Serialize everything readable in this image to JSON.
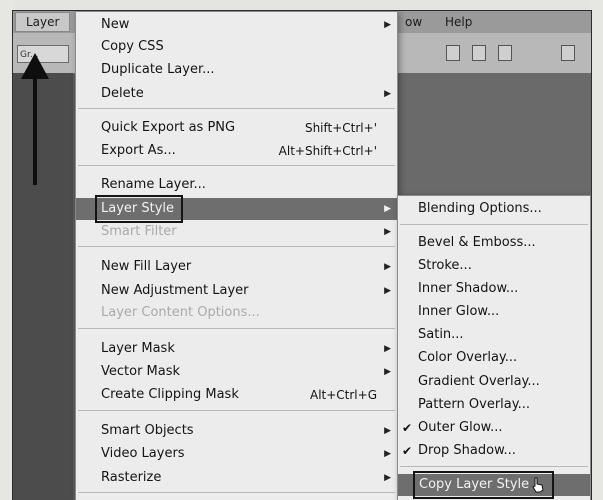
{
  "menubar": {
    "layer": "Layer",
    "window_fragment": "ow",
    "help": "Help",
    "mode_value": "Gr..."
  },
  "layer_menu": {
    "items": [
      {
        "label": "New"
      },
      {
        "label": "Copy CSS"
      },
      {
        "label": "Duplicate Layer..."
      },
      {
        "label": "Delete"
      },
      {
        "label": "Quick Export as PNG",
        "shortcut": "Shift+Ctrl+'"
      },
      {
        "label": "Export As...",
        "shortcut": "Alt+Shift+Ctrl+'"
      },
      {
        "label": "Rename Layer..."
      },
      {
        "label": "Layer Style"
      },
      {
        "label": "Smart Filter"
      },
      {
        "label": "New Fill Layer"
      },
      {
        "label": "New Adjustment Layer"
      },
      {
        "label": "Layer Content Options..."
      },
      {
        "label": "Layer Mask"
      },
      {
        "label": "Vector Mask"
      },
      {
        "label": "Create Clipping Mask",
        "shortcut": "Alt+Ctrl+G"
      },
      {
        "label": "Smart Objects"
      },
      {
        "label": "Video Layers"
      },
      {
        "label": "Rasterize"
      }
    ]
  },
  "layer_style_submenu": {
    "items": [
      {
        "label": "Blending Options..."
      },
      {
        "label": "Bevel & Emboss..."
      },
      {
        "label": "Stroke..."
      },
      {
        "label": "Inner Shadow..."
      },
      {
        "label": "Inner Glow..."
      },
      {
        "label": "Satin..."
      },
      {
        "label": "Color Overlay..."
      },
      {
        "label": "Gradient Overlay..."
      },
      {
        "label": "Pattern Overlay..."
      },
      {
        "label": "Outer Glow...",
        "checked": true
      },
      {
        "label": "Drop Shadow...",
        "checked": true
      },
      {
        "label": "Copy Layer Style"
      }
    ]
  },
  "colors": {
    "menu_bg": "#ececec",
    "highlight_bg": "#6e6e6e",
    "disabled_text": "#aaaaaa",
    "annotation": "#141414"
  },
  "icons": {
    "submenu_arrow": "triangle-right-icon",
    "check": "check-icon",
    "cursor": "hand-pointer-icon",
    "annotation_arrow": "up-arrow-icon"
  }
}
